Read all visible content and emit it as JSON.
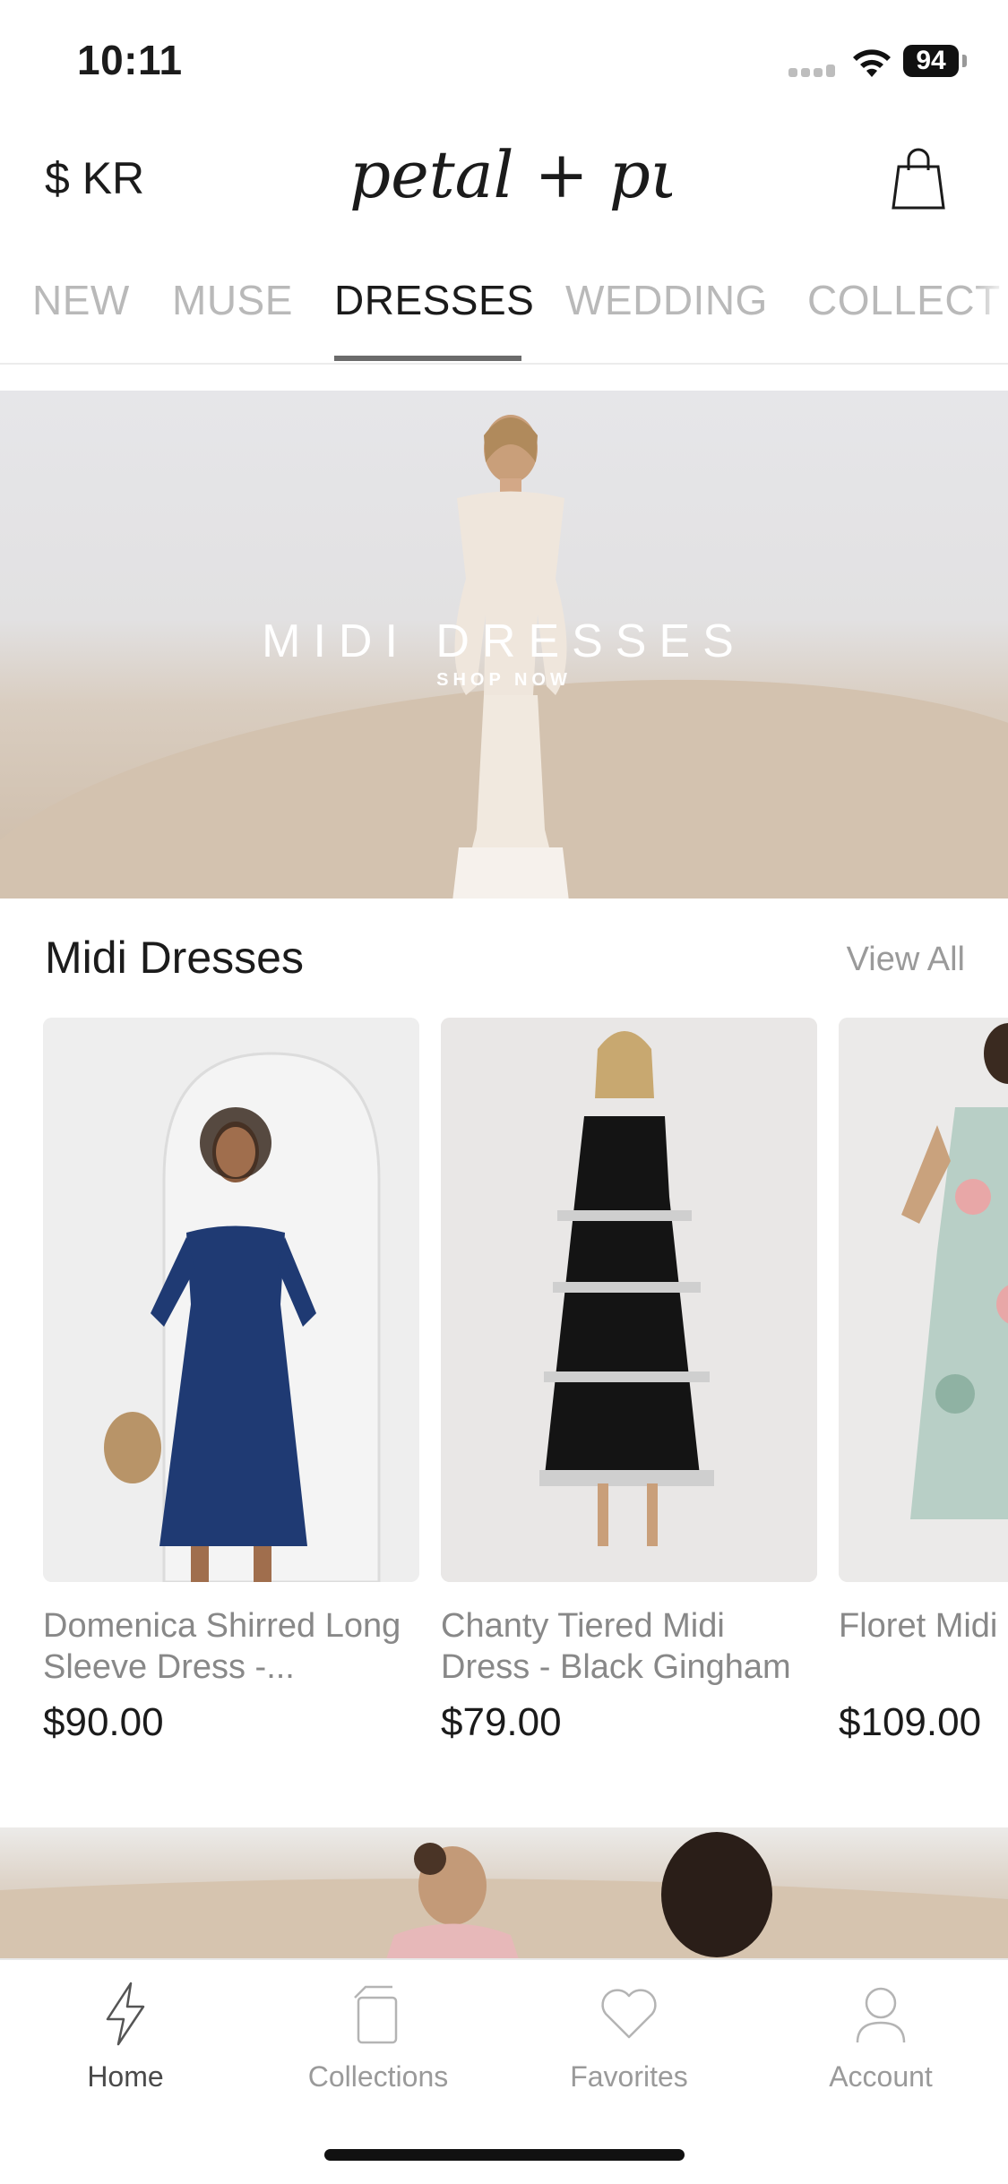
{
  "status_bar": {
    "time": "10:11",
    "battery": "94"
  },
  "header": {
    "currency": "$ KR",
    "logo_text": "petal + pup"
  },
  "tabs": [
    {
      "label": "NEW"
    },
    {
      "label": "MUSE"
    },
    {
      "label": "DRESSES"
    },
    {
      "label": "WEDDING"
    },
    {
      "label": "COLLECT"
    }
  ],
  "active_tab": "DRESSES",
  "hero": {
    "title": "MIDI DRESSES",
    "cta": "SHOP NOW"
  },
  "section": {
    "title": "Midi Dresses",
    "view_all": "View All"
  },
  "products": [
    {
      "name": "Domenica Shirred Long Sleeve Dress -...",
      "price": "$90.00",
      "dress_color": "#1f3a73",
      "bg_color": "#ececec"
    },
    {
      "name": "Chanty Tiered Midi Dress - Black Gingham",
      "price": "$79.00",
      "dress_color": "#141414",
      "bg_color": "#e9e7e6"
    },
    {
      "name": "Floret Midi Blue Multi",
      "price": "$109.00",
      "dress_color": "#9fb8b0",
      "bg_color": "#ebeae9"
    }
  ],
  "bottom_nav": [
    {
      "label": "Home",
      "icon": "lightning-icon"
    },
    {
      "label": "Collections",
      "icon": "collections-icon"
    },
    {
      "label": "Favorites",
      "icon": "heart-icon"
    },
    {
      "label": "Account",
      "icon": "person-icon"
    }
  ]
}
